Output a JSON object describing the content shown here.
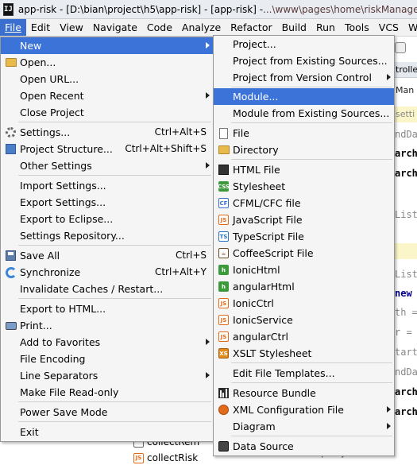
{
  "window": {
    "title": "app-risk - [D:\\bian\\project\\h5\\app-risk] - [app-risk] - ",
    "title_tail": "...\\www\\pages\\home\\riskManage"
  },
  "menubar": [
    "File",
    "Edit",
    "View",
    "Navigate",
    "Code",
    "Analyze",
    "Refactor",
    "Build",
    "Run",
    "Tools",
    "VCS",
    "Wind"
  ],
  "file_menu": {
    "new": "New",
    "open": "Open...",
    "open_url": "Open URL...",
    "open_recent": "Open Recent",
    "close_project": "Close Project",
    "settings": "Settings...",
    "settings_sc": "Ctrl+Alt+S",
    "project_structure": "Project Structure...",
    "project_structure_sc": "Ctrl+Alt+Shift+S",
    "other_settings": "Other Settings",
    "import_settings": "Import Settings...",
    "export_settings": "Export Settings...",
    "export_eclipse": "Export to Eclipse...",
    "settings_repo": "Settings Repository...",
    "save_all": "Save All",
    "save_all_sc": "Ctrl+S",
    "synchronize": "Synchronize",
    "synchronize_sc": "Ctrl+Alt+Y",
    "invalidate": "Invalidate Caches / Restart...",
    "export_html": "Export to HTML...",
    "print": "Print...",
    "add_favorites": "Add to Favorites",
    "file_encoding": "File Encoding",
    "line_separators": "Line Separators",
    "make_readonly": "Make File Read-only",
    "power_save": "Power Save Mode",
    "exit": "Exit"
  },
  "new_menu": {
    "project": "Project...",
    "project_existing": "Project from Existing Sources...",
    "project_vcs": "Project from Version Control",
    "module": "Module...",
    "module_existing": "Module from Existing Sources...",
    "file": "File",
    "directory": "Directory",
    "html_file": "HTML File",
    "stylesheet": "Stylesheet",
    "cfml": "CFML/CFC file",
    "javascript": "JavaScript File",
    "typescript": "TypeScript File",
    "coffeescript": "CoffeeScript File",
    "ionichtml": "IonicHtml",
    "angularhtml": "angularHtml",
    "ionicctrl": "IonicCtrl",
    "ionicservice": "IonicService",
    "angularctrl": "angularCtrl",
    "xslt": "XSLT Stylesheet",
    "edit_templates": "Edit File Templates...",
    "resource_bundle": "Resource Bundle",
    "xml_config": "XML Configuration File",
    "diagram": "Diagram",
    "data_source": "Data Source"
  },
  "icon_labels": {
    "css": "CSS",
    "cf": "CF",
    "js": "JS",
    "ts": "TS",
    "html": "h",
    "xslt": "XS"
  },
  "editor_tabs": [
    "trolle",
    "Man",
    "setti"
  ],
  "editor_lines": [
    "ndDat",
    "archC",
    "archC",
    "List",
    "List",
    "new",
    "th =",
    "r =",
    "tart",
    "ndDa",
    "archC",
    "archC",
    "queryList"
  ],
  "tree": [
    "collectRem",
    "collectRisk"
  ]
}
